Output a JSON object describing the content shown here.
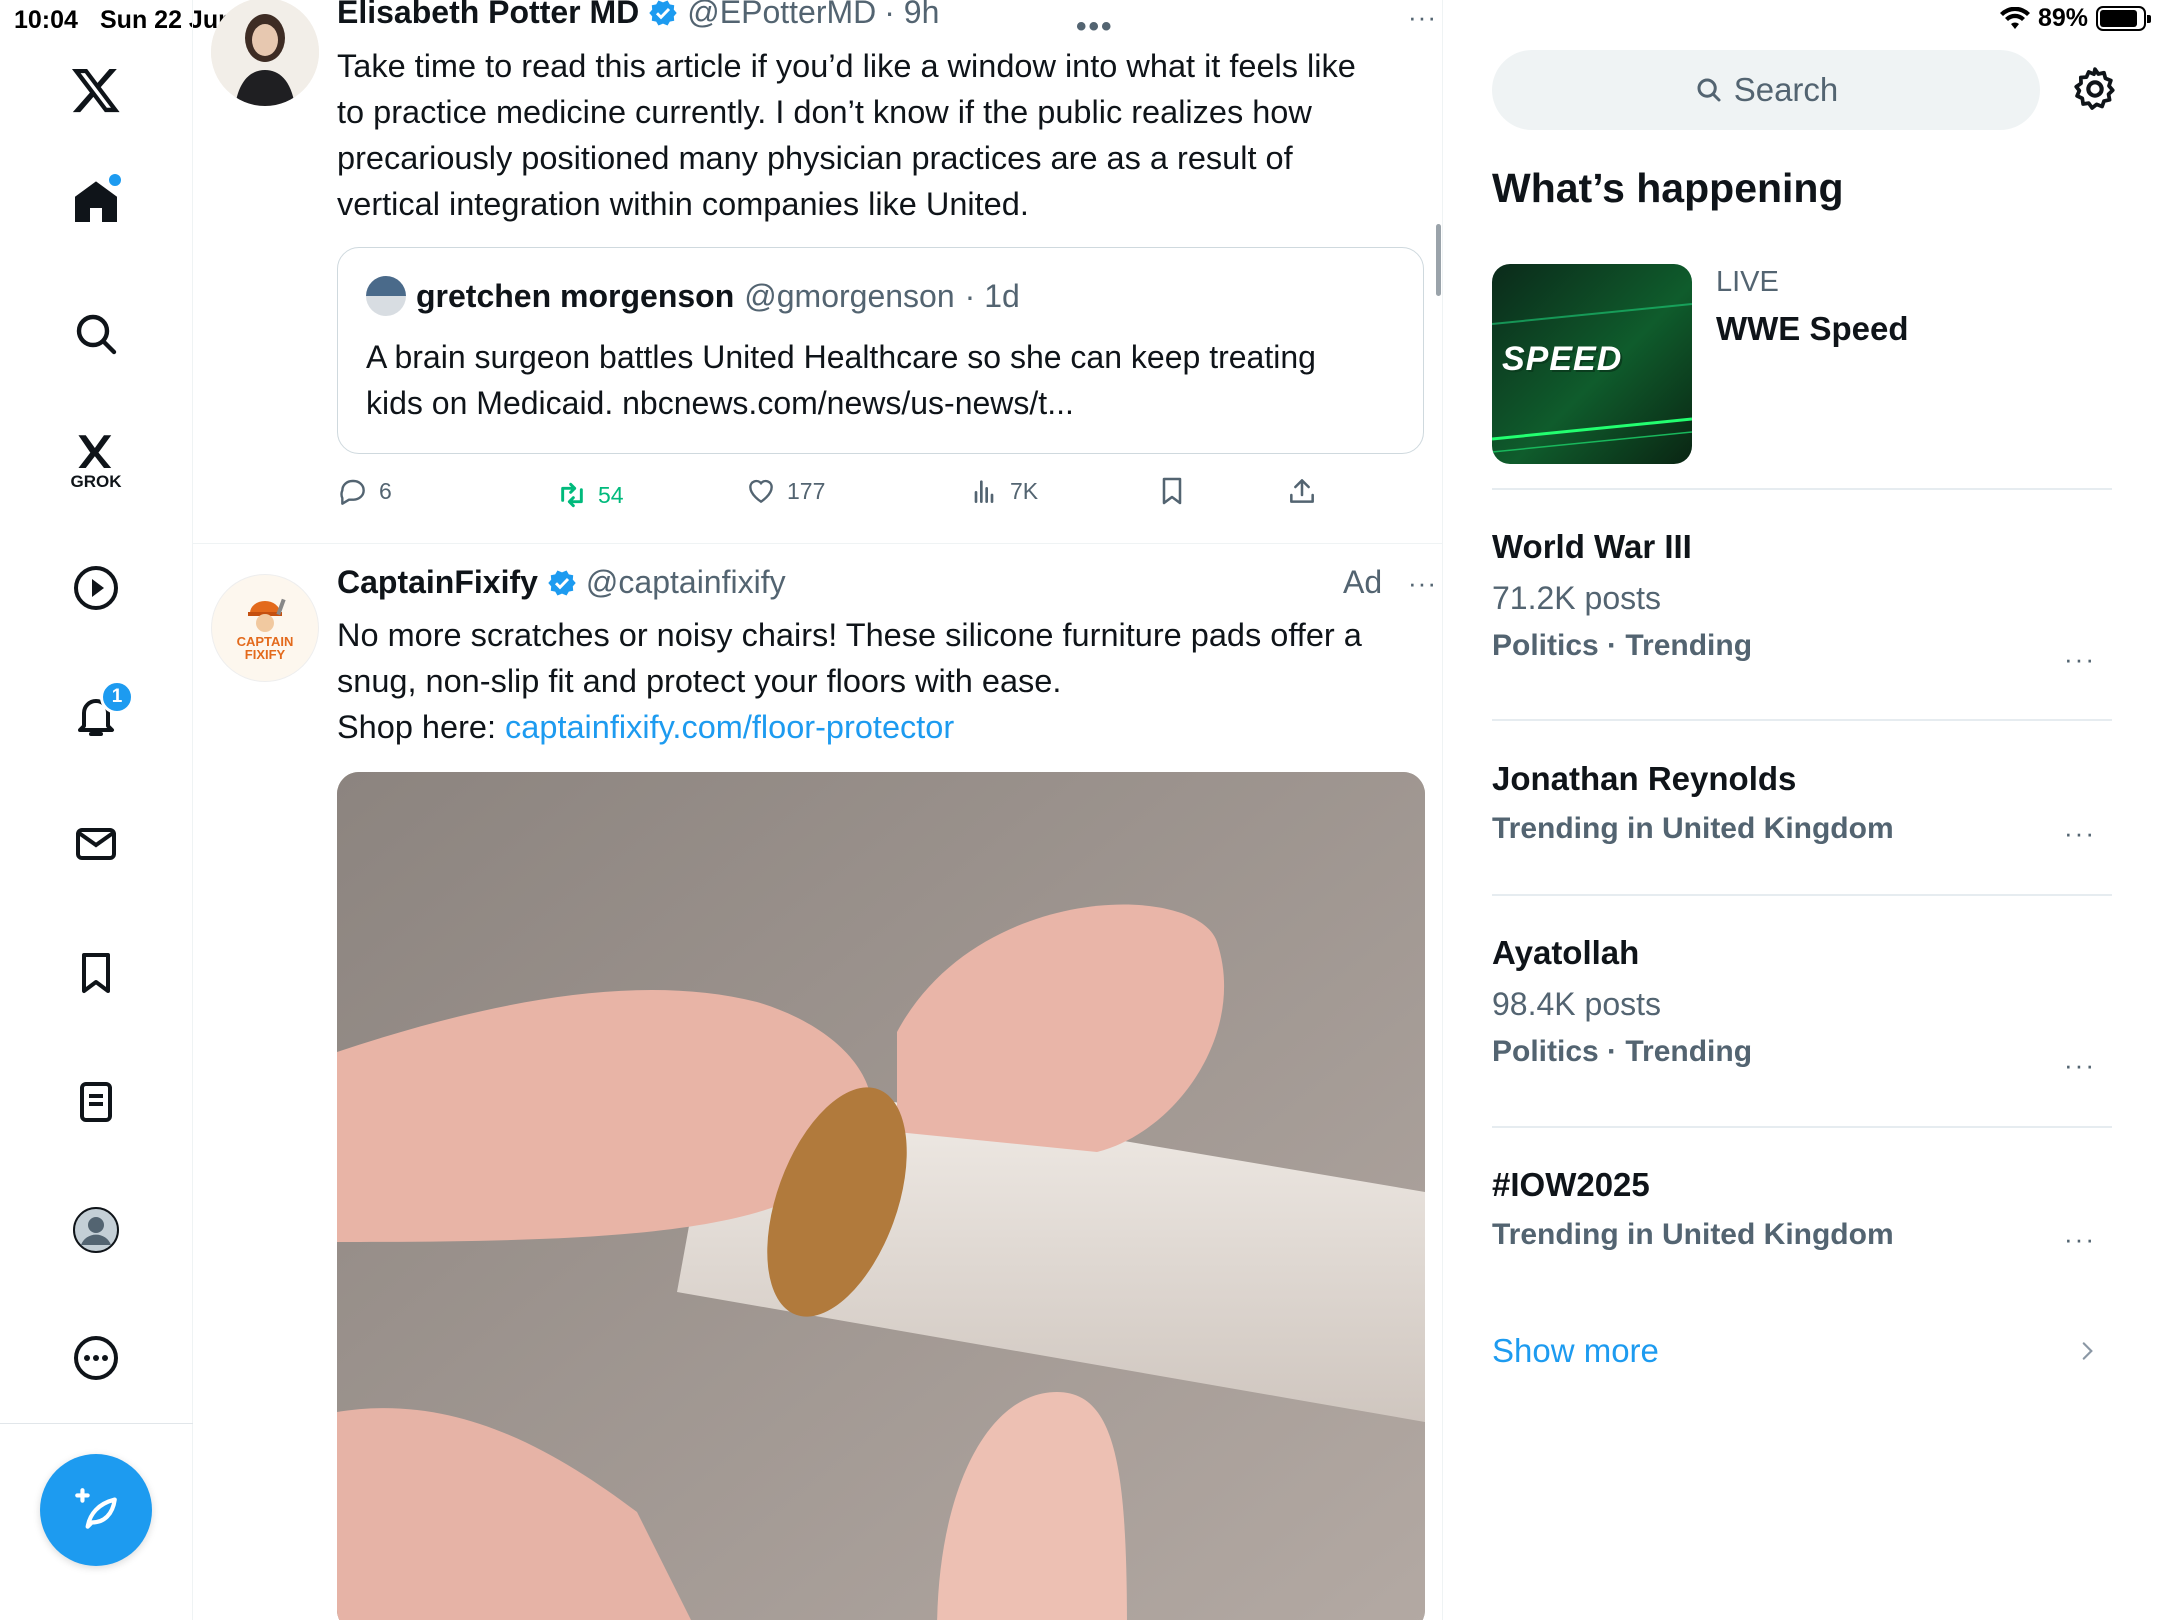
{
  "status_bar": {
    "time": "10:04",
    "date": "Sun 22 Jun",
    "battery": "89%",
    "battery_level": 0.89
  },
  "rail": {
    "grok_label": "GROK",
    "notifications_count": "1"
  },
  "tweet1": {
    "name": "Elisabeth Potter MD",
    "handle": "@EPotterMD",
    "time": "· 9h",
    "text_lines": [
      "Take time to read this article if you’d like a window into what it feels like",
      "to practice medicine currently. I don’t know if the public realizes how",
      "precariously positioned many physician practices are as a result of",
      "vertical integration within companies like United."
    ],
    "quote": {
      "name": "gretchen morgenson",
      "handle": "@gmorgenson",
      "time": "· 1d",
      "line1": "A brain surgeon battles United Healthcare so she can keep treating",
      "line2": "kids on Medicaid. nbcnews.com/news/us-news/t..."
    },
    "replies": "6",
    "reposts": "54",
    "likes": "177",
    "views": "7K"
  },
  "tweet2": {
    "name": "CaptainFixify",
    "handle": "@captainfixify",
    "ad_label": "Ad",
    "avatar_text": "CAPTAIN FIXIFY",
    "line1": "No more scratches or noisy chairs! These silicone furniture pads offer a",
    "line2": "snug, non-slip fit and protect your floors with ease.",
    "line3_prefix": "Shop here: ",
    "link": "captainfixify.com/floor-protector"
  },
  "sidebar": {
    "search_placeholder": "Search",
    "section_title": "What’s happening",
    "live": {
      "label": "LIVE",
      "title": "WWE Speed",
      "thumb_text": "SPEED"
    },
    "trends": [
      {
        "name": "World War III",
        "posts": "71.2K posts",
        "category": "Politics · Trending"
      },
      {
        "name": "Jonathan Reynolds",
        "category": "Trending in United Kingdom"
      },
      {
        "name": "Ayatollah",
        "posts": "98.4K posts",
        "category": "Politics · Trending"
      },
      {
        "name": "#IOW2025",
        "category": "Trending in United Kingdom"
      }
    ],
    "show_more": "Show more"
  },
  "colors": {
    "accent": "#1d9bf0",
    "repost_active": "#00ba7c",
    "muted": "#536471"
  }
}
